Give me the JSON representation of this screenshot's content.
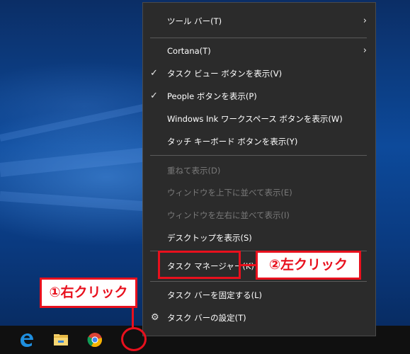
{
  "context_menu": {
    "items": [
      {
        "label": "ツール バー(T)",
        "submenu": true,
        "checked": false,
        "disabled": false
      },
      {
        "label": "Cortana(T)",
        "submenu": true,
        "checked": false,
        "disabled": false
      },
      {
        "label": "タスク ビュー ボタンを表示(V)",
        "submenu": false,
        "checked": true,
        "disabled": false
      },
      {
        "label": "People ボタンを表示(P)",
        "submenu": false,
        "checked": true,
        "disabled": false
      },
      {
        "label": "Windows Ink ワークスペース ボタンを表示(W)",
        "submenu": false,
        "checked": false,
        "disabled": false
      },
      {
        "label": "タッチ キーボード ボタンを表示(Y)",
        "submenu": false,
        "checked": false,
        "disabled": false
      },
      {
        "label": "重ねて表示(D)",
        "submenu": false,
        "checked": false,
        "disabled": true
      },
      {
        "label": "ウィンドウを上下に並べて表示(E)",
        "submenu": false,
        "checked": false,
        "disabled": true
      },
      {
        "label": "ウィンドウを左右に並べて表示(I)",
        "submenu": false,
        "checked": false,
        "disabled": true
      },
      {
        "label": "デスクトップを表示(S)",
        "submenu": false,
        "checked": false,
        "disabled": false
      },
      {
        "label": "タスク マネージャー(K)",
        "submenu": false,
        "checked": false,
        "disabled": false
      },
      {
        "label": "タスク バーを固定する(L)",
        "submenu": false,
        "checked": false,
        "disabled": false
      },
      {
        "label": "タスク バーの設定(T)",
        "submenu": false,
        "checked": false,
        "disabled": false
      }
    ]
  },
  "annotations": {
    "right_click": "①右クリック",
    "left_click": "②左クリック",
    "color": "#e8101d"
  },
  "taskbar": {
    "icons": [
      "edge-icon",
      "file-explorer-icon",
      "chrome-icon"
    ]
  }
}
